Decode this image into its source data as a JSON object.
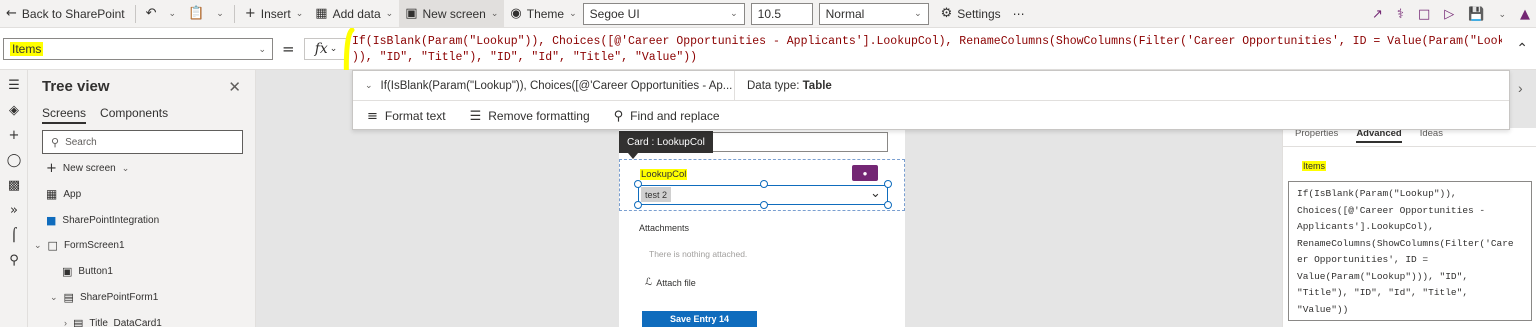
{
  "toolbar": {
    "back_label": "Back to SharePoint",
    "insert_label": "Insert",
    "add_data_label": "Add data",
    "new_screen_label": "New screen",
    "theme_label": "Theme",
    "font_value": "Segoe UI",
    "font_size_value": "10.5",
    "weight_value": "Normal",
    "settings_label": "Settings",
    "more_label": "⋯"
  },
  "formula_bar": {
    "property": "Items",
    "equals": "=",
    "fx_label": "fx",
    "formula_line1": "If(IsBlank(Param(\"Lookup\")), Choices([@'Career Opportunities - Applicants'].LookupCol), RenameColumns(ShowColumns(Filter('Career Opportunities', ID = Value(Param(\"Lookup\")",
    "formula_line2": ")), \"ID\", \"Title\"), \"ID\", \"Id\", \"Title\", \"Value\"))"
  },
  "formula_dropdown": {
    "expression_preview": "If(IsBlank(Param(\"Lookup\")), Choices([@'Career Opportunities - Ap...",
    "data_type_label": "Data type:",
    "data_type_value": "Table",
    "format_text_label": "Format text",
    "remove_formatting_label": "Remove formatting",
    "find_replace_label": "Find and replace"
  },
  "tree_view": {
    "title": "Tree view",
    "tabs": [
      "Screens",
      "Components"
    ],
    "search_placeholder": "Search",
    "new_screen_label": "New screen",
    "items": [
      "App",
      "SharePointIntegration",
      "FormScreen1",
      "Button1",
      "SharePointForm1",
      "Title_DataCard1"
    ]
  },
  "canvas": {
    "tooltip": "Card : LookupCol",
    "card_label": "LookupCol",
    "combo_value": "test 2",
    "attachments_label": "Attachments",
    "attachments_empty": "There is nothing attached.",
    "attach_file_label": "Attach file",
    "save_button_label": "Save Entry 14"
  },
  "properties_panel": {
    "tabs": [
      "Properties",
      "Advanced",
      "Ideas"
    ],
    "active_tab": "Advanced",
    "property_name": "Items",
    "code_lines": [
      "If(IsBlank(Param(\"Lookup\")),",
      "Choices([@'Career Opportunities -",
      "Applicants'].LookupCol),",
      "RenameColumns(ShowColumns(Filter('Care",
      "er Opportunities', ID =",
      "Value(Param(\"Lookup\"))), \"ID\",",
      "\"Title\"), \"ID\", \"Id\", \"Title\",",
      "\"Value\"))"
    ]
  },
  "colors": {
    "accent": "#0f6cbd",
    "brand_purple": "#742774",
    "highlight": "#ffff00"
  }
}
